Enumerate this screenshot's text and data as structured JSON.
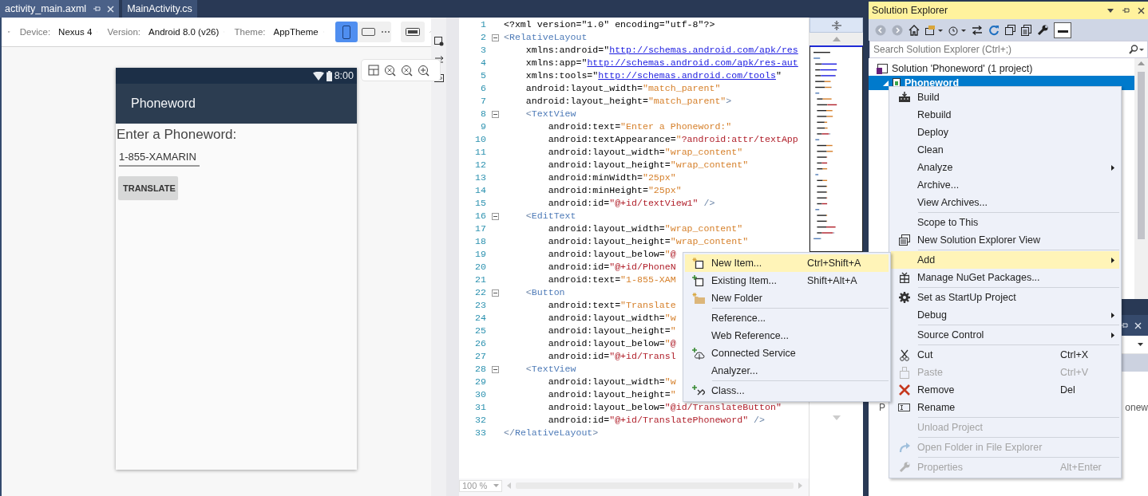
{
  "tabs": [
    {
      "label": "activity_main.axml",
      "selected": true
    },
    {
      "label": "MainActivity.cs",
      "selected": false
    }
  ],
  "designer": {
    "device_label": "Device:",
    "device": "Nexus 4",
    "version_label": "Version:",
    "version": "Android 8.0 (v26)",
    "theme_label": "Theme:",
    "theme": "AppTheme",
    "orientations": [
      {
        "kind": "portrait",
        "selected": true
      },
      {
        "kind": "landscape",
        "selected": false
      }
    ],
    "phone": {
      "time": "8:00",
      "app_title": "Phoneword",
      "prompt": "Enter a Phoneword:",
      "input_value": "1-855-XAMARIN",
      "button": "TRANSLATE"
    }
  },
  "editor": {
    "zoom": "100 %",
    "lines": [
      {
        "number": "1",
        "tokens": [
          {
            "kind": "plain",
            "text": "<?xml version=\"1.0\" encoding=\"utf-8\"?>"
          }
        ]
      },
      {
        "number": "2",
        "expanded": true,
        "tokens": [
          {
            "kind": "punct",
            "text": "<"
          },
          {
            "kind": "tag",
            "text": "RelativeLayout"
          }
        ]
      },
      {
        "number": "3",
        "tokens": [
          {
            "kind": "plain",
            "text": "    xmlns:android=\""
          },
          {
            "kind": "url",
            "text": "http://schemas.android.com/apk/res"
          }
        ]
      },
      {
        "number": "4",
        "tokens": [
          {
            "kind": "plain",
            "text": "    xmlns:app=\""
          },
          {
            "kind": "url",
            "text": "http://schemas.android.com/apk/res-aut"
          }
        ]
      },
      {
        "number": "5",
        "tokens": [
          {
            "kind": "plain",
            "text": "    xmlns:tools=\""
          },
          {
            "kind": "url",
            "text": "http://schemas.android.com/tools"
          },
          {
            "kind": "plain",
            "text": "\""
          }
        ]
      },
      {
        "number": "6",
        "tokens": [
          {
            "kind": "plain",
            "text": "    android:layout_width="
          },
          {
            "kind": "value",
            "text": "\"match_parent\""
          }
        ]
      },
      {
        "number": "7",
        "tokens": [
          {
            "kind": "plain",
            "text": "    android:layout_height="
          },
          {
            "kind": "value",
            "text": "\"match_parent\""
          },
          {
            "kind": "punct",
            "text": ">"
          }
        ]
      },
      {
        "number": "8",
        "expanded": true,
        "tokens": [
          {
            "kind": "punct",
            "text": "    <"
          },
          {
            "kind": "tag",
            "text": "TextView"
          }
        ]
      },
      {
        "number": "9",
        "tokens": [
          {
            "kind": "plain",
            "text": "        android:text="
          },
          {
            "kind": "value",
            "text": "\"Enter a Phoneword:\""
          }
        ]
      },
      {
        "number": "10",
        "tokens": [
          {
            "kind": "plain",
            "text": "        android:textAppearance="
          },
          {
            "kind": "value",
            "text": "\""
          },
          {
            "kind": "ref",
            "text": "?android:attr/textApp"
          }
        ]
      },
      {
        "number": "11",
        "tokens": [
          {
            "kind": "plain",
            "text": "        android:layout_width="
          },
          {
            "kind": "value",
            "text": "\"wrap_content\""
          }
        ]
      },
      {
        "number": "12",
        "tokens": [
          {
            "kind": "plain",
            "text": "        android:layout_height="
          },
          {
            "kind": "value",
            "text": "\"wrap_content\""
          }
        ]
      },
      {
        "number": "13",
        "tokens": [
          {
            "kind": "plain",
            "text": "        android:minWidth="
          },
          {
            "kind": "value",
            "text": "\"25px\""
          }
        ]
      },
      {
        "number": "14",
        "tokens": [
          {
            "kind": "plain",
            "text": "        android:minHeight="
          },
          {
            "kind": "value",
            "text": "\"25px\""
          }
        ]
      },
      {
        "number": "15",
        "tokens": [
          {
            "kind": "plain",
            "text": "        android:id="
          },
          {
            "kind": "ref",
            "text": "\"@+id/textView1\""
          },
          {
            "kind": "punct",
            "text": " />"
          }
        ]
      },
      {
        "number": "16",
        "expanded": true,
        "tokens": [
          {
            "kind": "punct",
            "text": "    <"
          },
          {
            "kind": "tag",
            "text": "EditText"
          }
        ]
      },
      {
        "number": "17",
        "tokens": [
          {
            "kind": "plain",
            "text": "        android:layout_width="
          },
          {
            "kind": "value",
            "text": "\"wrap_content\""
          }
        ]
      },
      {
        "number": "18",
        "tokens": [
          {
            "kind": "plain",
            "text": "        android:layout_height="
          },
          {
            "kind": "value",
            "text": "\"wrap_content\""
          }
        ]
      },
      {
        "number": "19",
        "tokens": [
          {
            "kind": "plain",
            "text": "        android:layout_below="
          },
          {
            "kind": "value",
            "text": "\""
          },
          {
            "kind": "ref",
            "text": "@"
          }
        ]
      },
      {
        "number": "20",
        "tokens": [
          {
            "kind": "plain",
            "text": "        android:id="
          },
          {
            "kind": "ref",
            "text": "\"@+id/PhoneN"
          }
        ]
      },
      {
        "number": "21",
        "tokens": [
          {
            "kind": "plain",
            "text": "        android:text="
          },
          {
            "kind": "value",
            "text": "\"1-855-XAM"
          }
        ]
      },
      {
        "number": "22",
        "expanded": true,
        "tokens": [
          {
            "kind": "punct",
            "text": "    <"
          },
          {
            "kind": "tag",
            "text": "Button"
          }
        ]
      },
      {
        "number": "23",
        "tokens": [
          {
            "kind": "plain",
            "text": "        android:text="
          },
          {
            "kind": "value",
            "text": "\"Translate"
          }
        ]
      },
      {
        "number": "24",
        "tokens": [
          {
            "kind": "plain",
            "text": "        android:layout_width="
          },
          {
            "kind": "value",
            "text": "\"w"
          }
        ]
      },
      {
        "number": "25",
        "tokens": [
          {
            "kind": "plain",
            "text": "        android:layout_height="
          },
          {
            "kind": "value",
            "text": "\""
          }
        ]
      },
      {
        "number": "26",
        "tokens": [
          {
            "kind": "plain",
            "text": "        android:layout_below="
          },
          {
            "kind": "value",
            "text": "\""
          },
          {
            "kind": "ref",
            "text": "@"
          }
        ]
      },
      {
        "number": "27",
        "tokens": [
          {
            "kind": "plain",
            "text": "        android:id="
          },
          {
            "kind": "ref",
            "text": "\"@+id/Transl"
          }
        ]
      },
      {
        "number": "28",
        "expanded": true,
        "tokens": [
          {
            "kind": "punct",
            "text": "    <"
          },
          {
            "kind": "tag",
            "text": "TextView"
          }
        ]
      },
      {
        "number": "29",
        "tokens": [
          {
            "kind": "plain",
            "text": "        android:layout_width="
          },
          {
            "kind": "value",
            "text": "\"w"
          }
        ]
      },
      {
        "number": "30",
        "tokens": [
          {
            "kind": "plain",
            "text": "        android:layout_height="
          },
          {
            "kind": "value",
            "text": "\""
          }
        ]
      },
      {
        "number": "31",
        "tokens": [
          {
            "kind": "plain",
            "text": "        android:layout_below="
          },
          {
            "kind": "ref",
            "text": "\"@id/TranslateButton\""
          }
        ]
      },
      {
        "number": "32",
        "tokens": [
          {
            "kind": "plain",
            "text": "        android:id="
          },
          {
            "kind": "ref",
            "text": "\"@+id/TranslatePhoneword\""
          },
          {
            "kind": "punct",
            "text": " />"
          }
        ]
      },
      {
        "number": "33",
        "tokens": [
          {
            "kind": "punct",
            "text": "</"
          },
          {
            "kind": "tag",
            "text": "RelativeLayout"
          },
          {
            "kind": "punct",
            "text": ">"
          }
        ]
      }
    ]
  },
  "solution_explorer": {
    "title": "Solution Explorer",
    "search_placeholder": "Search Solution Explorer (Ctrl+;)",
    "tree": [
      {
        "label": "Solution 'Phoneword' (1 project)",
        "selected": false,
        "children": [
          {
            "label": "Phoneword",
            "selected": true,
            "expanded": true
          }
        ]
      }
    ]
  },
  "lower_panel": {
    "cell_1": "P",
    "cell_2": "onew"
  },
  "context_menu": [
    {
      "kind": "item",
      "label": "Build",
      "selected": false,
      "disabled": false,
      "submenu": false
    },
    {
      "kind": "item",
      "label": "Rebuild",
      "selected": false,
      "disabled": false,
      "submenu": false
    },
    {
      "kind": "item",
      "label": "Deploy",
      "selected": false,
      "disabled": false,
      "submenu": false
    },
    {
      "kind": "item",
      "label": "Clean",
      "selected": false,
      "disabled": false,
      "submenu": false
    },
    {
      "kind": "item",
      "label": "Analyze",
      "selected": false,
      "disabled": false,
      "submenu": true
    },
    {
      "kind": "item",
      "label": "Archive...",
      "selected": false,
      "disabled": false,
      "submenu": false
    },
    {
      "kind": "item",
      "label": "View Archives...",
      "selected": false,
      "disabled": false,
      "submenu": false
    },
    {
      "kind": "separator"
    },
    {
      "kind": "item",
      "label": "Scope to This",
      "selected": false,
      "disabled": false,
      "submenu": false
    },
    {
      "kind": "item",
      "label": "New Solution Explorer View",
      "selected": false,
      "disabled": false,
      "submenu": false
    },
    {
      "kind": "separator"
    },
    {
      "kind": "item",
      "label": "Add",
      "selected": true,
      "disabled": false,
      "submenu": true
    },
    {
      "kind": "item",
      "label": "Manage NuGet Packages...",
      "selected": false,
      "disabled": false,
      "submenu": false
    },
    {
      "kind": "separator"
    },
    {
      "kind": "item",
      "label": "Set as StartUp Project",
      "selected": false,
      "disabled": false,
      "submenu": false
    },
    {
      "kind": "item",
      "label": "Debug",
      "selected": false,
      "disabled": false,
      "submenu": true
    },
    {
      "kind": "separator"
    },
    {
      "kind": "item",
      "label": "Source Control",
      "selected": false,
      "disabled": false,
      "submenu": true
    },
    {
      "kind": "separator"
    },
    {
      "kind": "item",
      "label": "Cut",
      "shortcut": "Ctrl+X",
      "selected": false,
      "disabled": false,
      "submenu": false
    },
    {
      "kind": "item",
      "label": "Paste",
      "shortcut": "Ctrl+V",
      "selected": false,
      "disabled": true,
      "submenu": false
    },
    {
      "kind": "item",
      "label": "Remove",
      "shortcut": "Del",
      "selected": false,
      "disabled": false,
      "submenu": false
    },
    {
      "kind": "item",
      "label": "Rename",
      "selected": false,
      "disabled": false,
      "submenu": false
    },
    {
      "kind": "separator"
    },
    {
      "kind": "item",
      "label": "Unload Project",
      "selected": false,
      "disabled": true,
      "submenu": false
    },
    {
      "kind": "separator"
    },
    {
      "kind": "item",
      "label": "Open Folder in File Explorer",
      "selected": false,
      "disabled": true,
      "submenu": false
    },
    {
      "kind": "separator"
    },
    {
      "kind": "item",
      "label": "Properties",
      "shortcut": "Alt+Enter",
      "selected": false,
      "disabled": true,
      "submenu": false
    }
  ],
  "add_submenu": [
    {
      "kind": "item",
      "label": "New Item...",
      "shortcut": "Ctrl+Shift+A",
      "selected": true
    },
    {
      "kind": "item",
      "label": "Existing Item...",
      "shortcut": "Shift+Alt+A",
      "selected": false
    },
    {
      "kind": "item",
      "label": "New Folder",
      "selected": false
    },
    {
      "kind": "separator"
    },
    {
      "kind": "item",
      "label": "Reference...",
      "selected": false
    },
    {
      "kind": "item",
      "label": "Web Reference...",
      "selected": false
    },
    {
      "kind": "item",
      "label": "Connected Service",
      "selected": false
    },
    {
      "kind": "item",
      "label": "Analyzer...",
      "selected": false
    },
    {
      "kind": "separator"
    },
    {
      "kind": "item",
      "label": "Class...",
      "selected": false
    }
  ]
}
